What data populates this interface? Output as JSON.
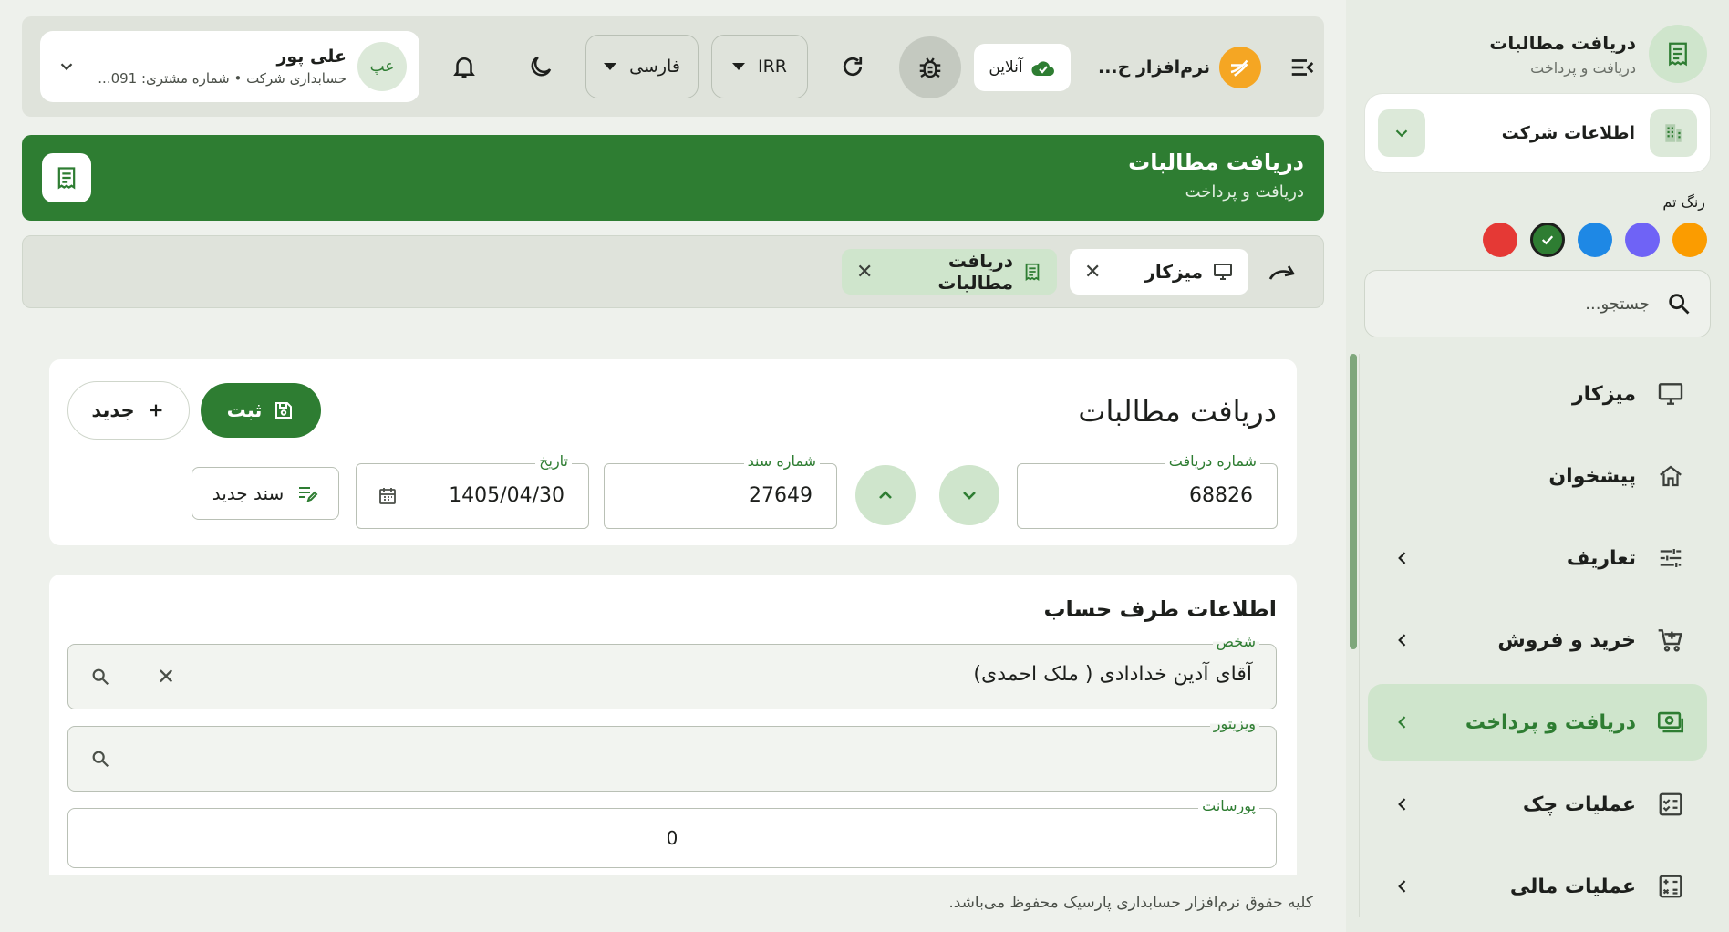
{
  "sidebar": {
    "header_title": "دریافت مطالبات",
    "header_subtitle": "دریافت و پرداخت",
    "company_label": "اطلاعات شرکت",
    "theme_label": "رنگ تم",
    "theme_colors": [
      "#fb9c00",
      "#6f63f6",
      "#1e88e5",
      "#2e7d32",
      "#e53935"
    ],
    "selected_theme": "#2e7d32",
    "search_placeholder": "جستجو...",
    "items": [
      {
        "label": "میزکار",
        "icon": "desktop-icon",
        "has_children": false,
        "active": false
      },
      {
        "label": "پیشخوان",
        "icon": "home-icon",
        "has_children": false,
        "active": false
      },
      {
        "label": "تعاریف",
        "icon": "sliders-icon",
        "has_children": true,
        "active": false
      },
      {
        "label": "خرید و فروش",
        "icon": "cart-icon",
        "has_children": true,
        "active": false
      },
      {
        "label": "دریافت و پرداخت",
        "icon": "cash-icon",
        "has_children": true,
        "active": true
      },
      {
        "label": "عملیات چک",
        "icon": "check-list-icon",
        "has_children": true,
        "active": false
      },
      {
        "label": "عملیات مالی",
        "icon": "calculator-icon",
        "has_children": true,
        "active": false
      }
    ]
  },
  "topbar": {
    "user_name": "علی پور",
    "user_sub": "حسابداری شرکت • شماره مشتری: 091...",
    "avatar_text": "عپ",
    "language": "فارسی",
    "currency": "IRR",
    "online_label": "آنلاین",
    "brand_name": "نرم‌افزار ح..."
  },
  "page_header": {
    "title": "دریافت مطالبات",
    "subtitle": "دریافت و پرداخت"
  },
  "tabs": [
    {
      "label": "میزکار",
      "icon": "desktop-icon"
    },
    {
      "label": "دریافت مطالبات",
      "icon": "receipt-icon",
      "active": true
    }
  ],
  "form": {
    "title": "دریافت مطالبات",
    "save_label": "ثبت",
    "new_label": "جدید",
    "receipt_no_label": "شماره دریافت",
    "receipt_no": "68826",
    "doc_no_label": "شماره سند",
    "doc_no": "27649",
    "date_label": "تاریخ",
    "date": "1405/04/30",
    "new_doc_label": "سند جدید"
  },
  "account": {
    "section_title": "اطلاعات طرف حساب",
    "person_label": "شخص",
    "person_value": "آقای آدین خدادادی ( ملک احمدی)",
    "visitor_label": "ویزیتور",
    "visitor_value": "",
    "commission_label": "پورسانت",
    "commission_value": "0"
  },
  "footer": "کلیه حقوق نرم‌افزار حسابداری پارسیک محفوظ می‌باشد."
}
